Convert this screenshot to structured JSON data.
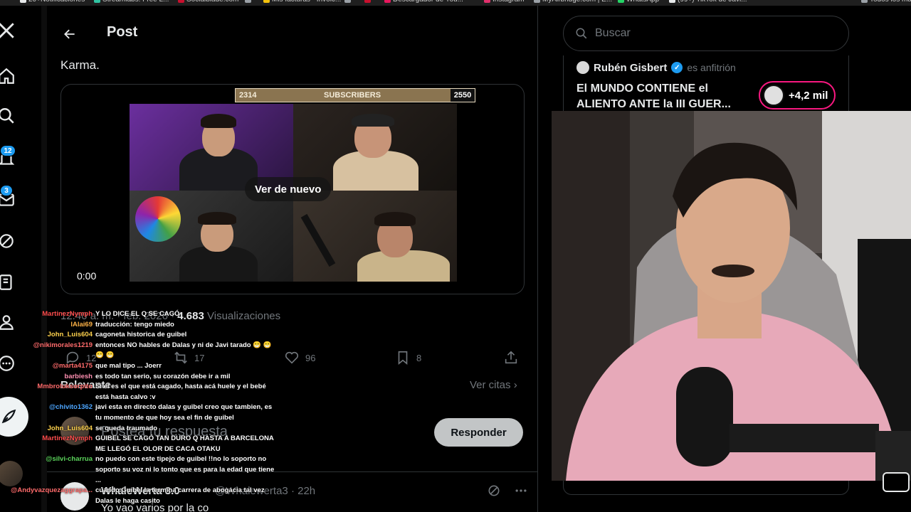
{
  "bookmarks": [
    {
      "label": "20+Notificaciones",
      "color": "#e7e9ea"
    },
    {
      "label": "Streamlabs: Free L...",
      "color": "#31c3a2"
    },
    {
      "label": "Socialblade.com",
      "color": "#c8102e"
    },
    {
      "label": "",
      "color": "#9aa0a6"
    },
    {
      "label": "Mis facturas - Invoic...",
      "color": "#f4c20d"
    },
    {
      "label": "",
      "color": "#9aa0a6"
    },
    {
      "label": "",
      "color": "#c8102e"
    },
    {
      "label": "Descargador de You...",
      "color": "#e8175d"
    },
    {
      "label": "Instagram",
      "color": "#e1306c"
    },
    {
      "label": "MyAirbridge.com | E...",
      "color": "#9aa0a6"
    },
    {
      "label": "WhatsApp",
      "color": "#25d366"
    },
    {
      "label": "(99+) TikTok de Javi...",
      "color": "#e7e9ea"
    },
    {
      "label": "Todos los ma",
      "color": "#9aa0a6"
    }
  ],
  "nav": {
    "badges": {
      "notifications": "12",
      "messages": "3"
    }
  },
  "header": {
    "title": "Post"
  },
  "post": {
    "text": "Karma.",
    "video": {
      "replay_label": "Ver de nuevo",
      "time": "0:00",
      "sub_left": "2314",
      "sub_label": "SUBSCRIBERS",
      "sub_right": "2550",
      "sub_progress": 0.9
    },
    "meta": {
      "time": "12:40 a. m.",
      "date": "feb. 2026",
      "views": "4.683",
      "views_label": "Visualizaciones"
    },
    "actions": {
      "replies": "12",
      "reposts": "17",
      "likes": "96",
      "bookmarks": "8"
    }
  },
  "replies_section": {
    "relevant_label": "Relevante",
    "quotes_label": "Ver citas",
    "reply_placeholder": "Postea tu respuesta",
    "reply_button": "Responder"
  },
  "comment": {
    "name": "WhaleWerta 3.0",
    "handle": "@Whalewerta3",
    "time": "22h",
    "body": "Yo vao varios por la co"
  },
  "chat": [
    {
      "user": "MartinezNymph",
      "text": "Y LO DICE EL Q SE CAGÓ",
      "color": "#ff4d4d"
    },
    {
      "user": "lAlai69",
      "text": "traducción: tengo miedo",
      "color": "#ffb347"
    },
    {
      "user": "John_Luis604",
      "text": "cagoneta historica de guibel",
      "color": "#ffd24d"
    },
    {
      "user": "@nikimorales1219",
      "text": "entonces NO hables de Dalas y ni de Javi tarado 😁 😁",
      "color": "#ff6b6b"
    },
    {
      "user": "",
      "text": "😁 😁",
      "color": "#ffffff"
    },
    {
      "user": "@marta4175",
      "text": "que mal tipo ... Joerr",
      "color": "#ff6b6b"
    },
    {
      "user": "barbiesh",
      "text": "es todo tan serio, su corazón debe ir a mil",
      "color": "#ff8fb1"
    },
    {
      "user": "Mmbroluksorpito",
      "text": "Si el es el que está cagado, hasta acá huele y el bebé",
      "color": "#ff6b6b"
    },
    {
      "user": "",
      "text": "está hasta calvo :v",
      "color": "#ffffff"
    },
    {
      "user": "@chivito1362",
      "text": "javi esta en directo dalas y guibel creo que tambien, es",
      "color": "#4da6ff"
    },
    {
      "user": "",
      "text": "tu momento de que hoy sea el fin de guibel",
      "color": "#ffffff"
    },
    {
      "user": "John_Luis604",
      "text": "se queda traumado",
      "color": "#ffd24d"
    },
    {
      "user": "MartinezNymph",
      "text": "GUIBEL SE CAGÓ TAN DURO Q HASTA A BARCELONA",
      "color": "#ff4d4d"
    },
    {
      "user": "",
      "text": "ME LLEGÓ EL OLOR DE CACA OTAKU",
      "color": "#ffffff"
    },
    {
      "user": "@silvi-charrua",
      "text": "no puedo con este tipejo de guibel !!no lo soporto no",
      "color": "#5cd65c"
    },
    {
      "user": "",
      "text": "soporto su voz ni lo tonto que es para la edad que tiene",
      "color": "#ffffff"
    },
    {
      "user": "",
      "text": "...",
      "color": "#ffffff"
    },
    {
      "user": "@Andyvazquezaggrapa...",
      "text": "cuando Guibel la termina carrera de abogacia tal vez",
      "color": "#ff6b6b"
    },
    {
      "user": "",
      "text": "Dalas le haga casito",
      "color": "#ffffff"
    }
  ],
  "sidebar": {
    "search_placeholder": "Buscar",
    "space": {
      "host": "Rubén Gisbert",
      "role": "es anfitrión",
      "title_line1": "El MUNDO CONTIENE el",
      "title_line2": "ALIENTO ANTE la III GUER...",
      "listeners": "+4,2 mil"
    }
  }
}
